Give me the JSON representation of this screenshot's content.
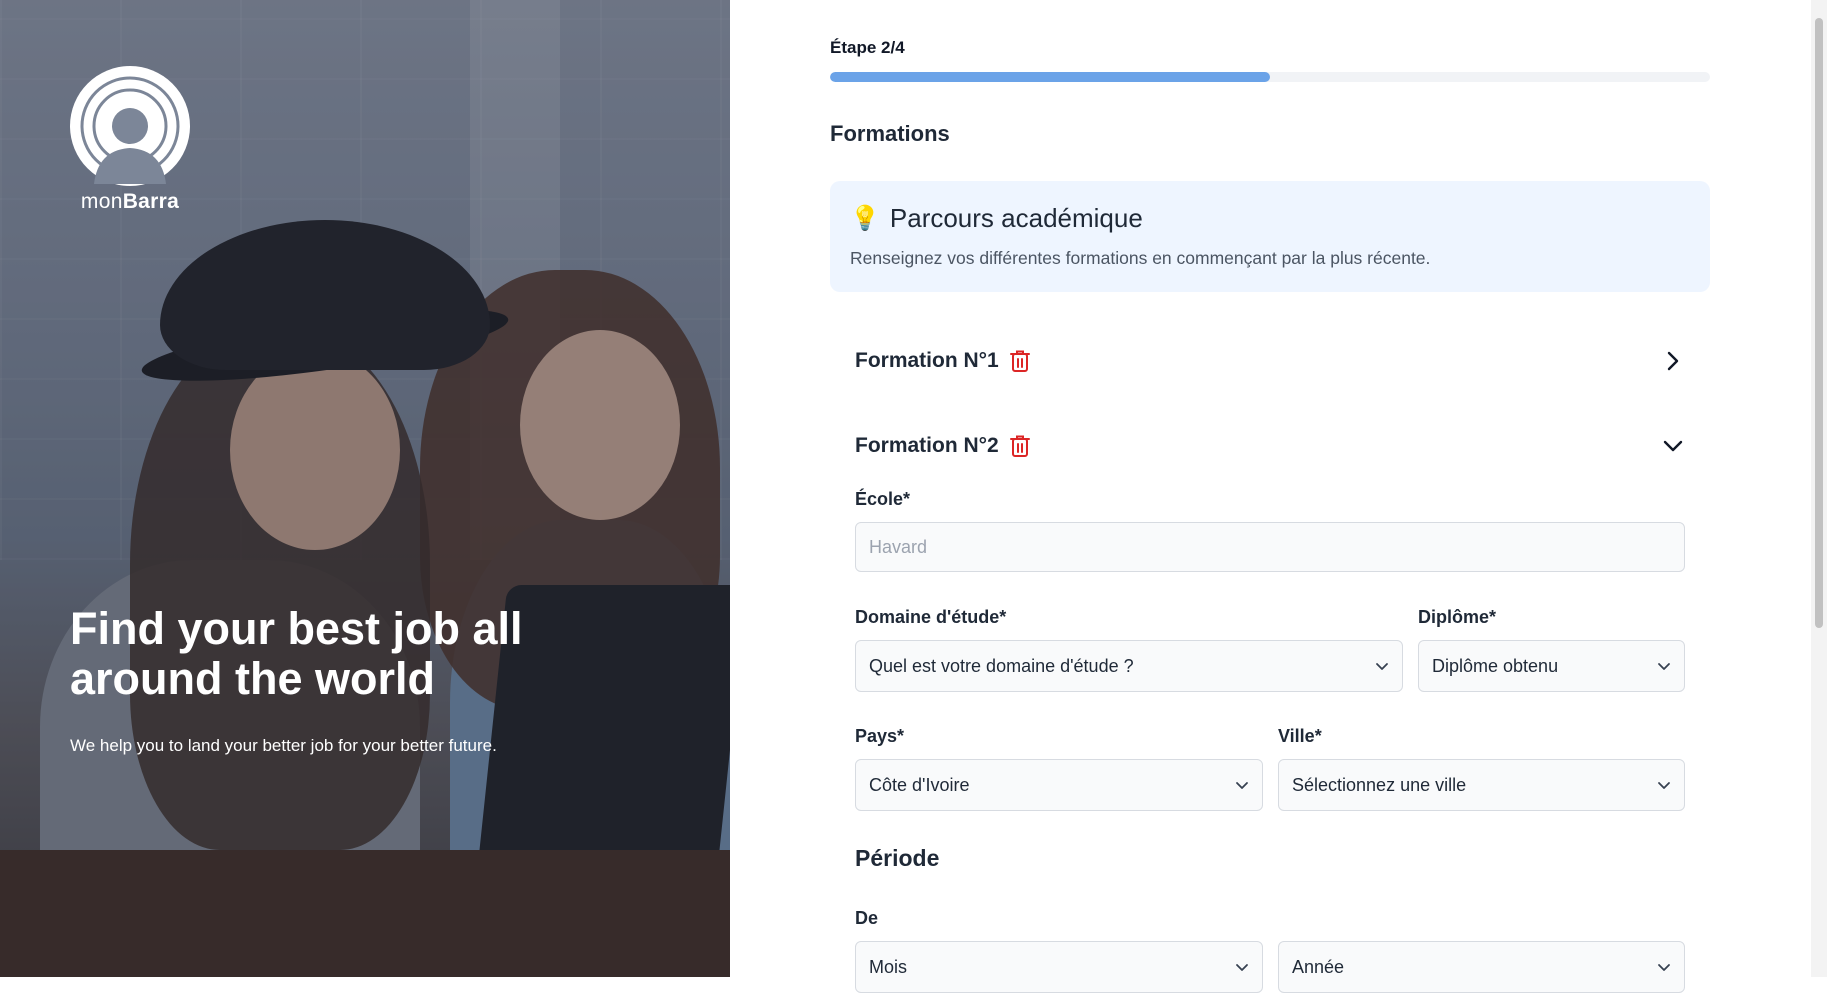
{
  "brand": {
    "prefix": "mon",
    "name": "Barra"
  },
  "hero": {
    "title": "Find your best job all around the world",
    "subtitle": "We help you to land your better job for your better future."
  },
  "progress": {
    "label": "Étape 2/4",
    "fraction": 0.5
  },
  "section": {
    "title": "Formations"
  },
  "info": {
    "icon": "💡",
    "title": "Parcours académique",
    "text": "Renseignez vos différentes formations en commençant par la plus récente."
  },
  "formations": [
    {
      "title": "Formation N°1",
      "expanded": false
    },
    {
      "title": "Formation N°2",
      "expanded": true
    }
  ],
  "form": {
    "school": {
      "label": "École*",
      "placeholder": "Havard"
    },
    "field": {
      "label": "Domaine d'étude*",
      "value": "Quel est votre domaine d'étude ?"
    },
    "degree": {
      "label": "Diplôme*",
      "value": "Diplôme obtenu"
    },
    "country": {
      "label": "Pays*",
      "value": "Côte d'Ivoire"
    },
    "city": {
      "label": "Ville*",
      "value": "Sélectionnez une ville"
    },
    "period": {
      "title": "Période",
      "from_label": "De",
      "month": "Mois",
      "year": "Année"
    }
  },
  "colors": {
    "progress": "#6ba3e8",
    "info_bg": "#eef5ff",
    "trash": "#dc2626"
  }
}
